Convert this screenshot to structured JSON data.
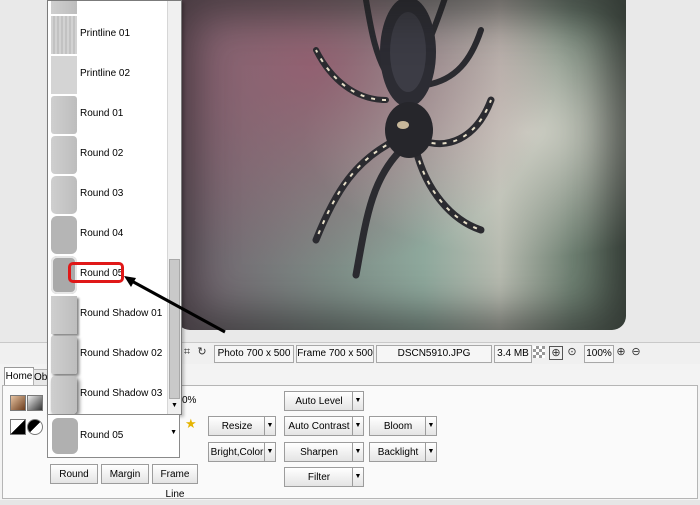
{
  "frame_list": {
    "items": [
      {
        "label": ""
      },
      {
        "label": "Printline 01"
      },
      {
        "label": "Printline 02"
      },
      {
        "label": "Round 01"
      },
      {
        "label": "Round 02"
      },
      {
        "label": "Round 03"
      },
      {
        "label": "Round 04"
      },
      {
        "label": "Round 05"
      },
      {
        "label": "Round Shadow 01"
      },
      {
        "label": "Round Shadow 02"
      },
      {
        "label": "Round Shadow 03"
      }
    ],
    "selected_label": "Round 05",
    "highlight_color": "#e01818"
  },
  "status_bar": {
    "photo_size": "Photo 700 x 500",
    "frame_size": "Frame 700 x 500",
    "file_name": "DSCN5910.JPG",
    "file_size": "3.4 MB",
    "zoom": "100%"
  },
  "ribbon": {
    "tabs": {
      "home": "Home",
      "objects": "Obj"
    },
    "partial_zoom": "0%",
    "frame_buttons": {
      "round": "Round",
      "margin": "Margin",
      "frame_line": "Frame Line"
    },
    "adjust_buttons": {
      "resize": "Resize",
      "bright_color": "Bright,Color",
      "auto_level": "Auto Level",
      "auto_contrast": "Auto Contrast",
      "sharpen": "Sharpen",
      "filter": "Filter",
      "bloom": "Bloom",
      "backlight": "Backlight"
    }
  }
}
